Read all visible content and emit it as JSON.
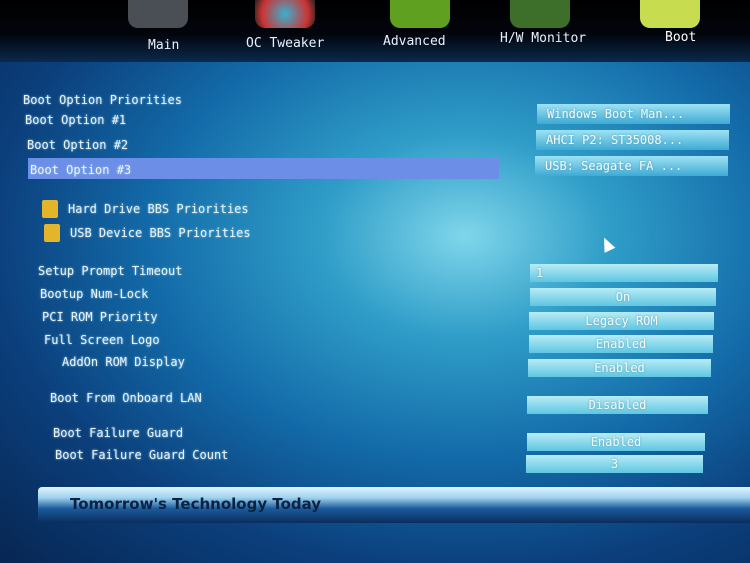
{
  "tabs": [
    {
      "label": "Main"
    },
    {
      "label": "OC Tweaker"
    },
    {
      "label": "Advanced"
    },
    {
      "label": "H/W Monitor"
    },
    {
      "label": "Boot"
    }
  ],
  "active_tab": "Boot",
  "section_title": "Boot Option Priorities",
  "boot_options": [
    {
      "label": "Boot Option #1",
      "value": "Windows Boot Man..."
    },
    {
      "label": "Boot Option #2",
      "value": "AHCI P2: ST35008..."
    },
    {
      "label": "Boot Option #3",
      "value": "USB: Seagate FA ..."
    }
  ],
  "submenus": [
    {
      "label": "Hard Drive BBS Priorities"
    },
    {
      "label": "USB Device BBS Priorities"
    }
  ],
  "settings": [
    {
      "label": "Setup Prompt Timeout",
      "value": "1"
    },
    {
      "label": "Bootup Num-Lock",
      "value": "On"
    },
    {
      "label": "PCI ROM Priority",
      "value": "Legacy ROM"
    },
    {
      "label": "Full Screen Logo",
      "value": "Enabled"
    },
    {
      "label": "AddOn ROM Display",
      "value": "Enabled"
    },
    {
      "label": "Boot From Onboard LAN",
      "value": "Disabled"
    },
    {
      "label": "Boot Failure Guard",
      "value": "Enabled"
    },
    {
      "label": "Boot Failure Guard Count",
      "value": "3"
    }
  ],
  "footer": "Tomorrow's Technology Today",
  "colors": {
    "selection": "#6d8ee6",
    "value_box": "#5fc6e2",
    "folder": "#e3b52a"
  }
}
